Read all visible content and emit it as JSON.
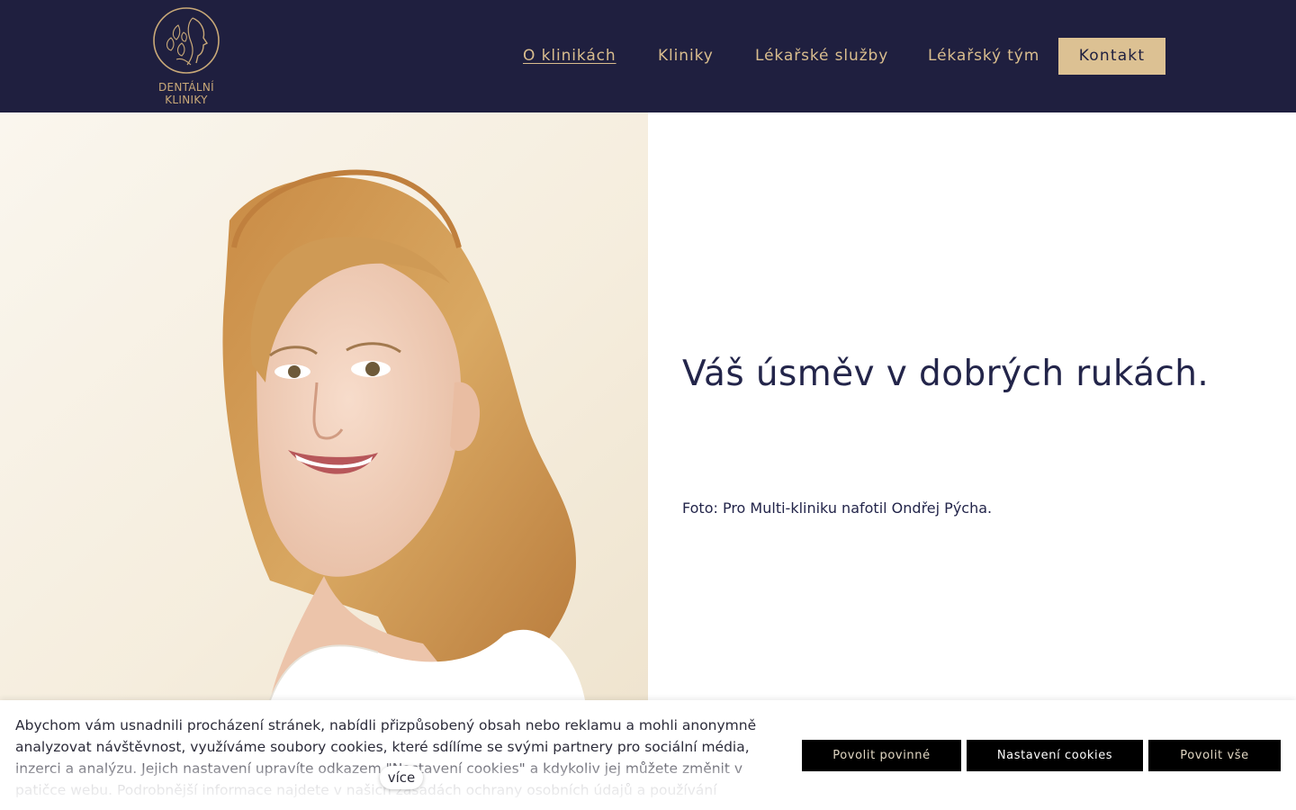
{
  "colors": {
    "header_bg": "#1f1f3f",
    "accent_gold": "#d9bd8e",
    "contact_button_bg": "#dcc193",
    "title_color": "#23254a",
    "cookie_button_bg": "#000000"
  },
  "brand": {
    "logo_icon": "face-leaf-logo-icon",
    "logo_line1": "DENTÁLNÍ",
    "logo_line2": "KLINIKY"
  },
  "nav": {
    "items": [
      {
        "label": "O klinikách",
        "active": true
      },
      {
        "label": "Kliniky",
        "active": false
      },
      {
        "label": "Lékařské služby",
        "active": false
      },
      {
        "label": "Lékařský tým",
        "active": false
      }
    ],
    "contact_label": "Kontakt"
  },
  "hero": {
    "title": "Váš úsměv v dobrých rukách.",
    "caption": "Foto: Pro Multi-kliniku nafotil Ondřej Pýcha."
  },
  "cookies": {
    "text": "Abychom vám usnadnili procházení stránek, nabídli přizpůsobený obsah nebo reklamu a mohli anonymně analyzovat návštěvnost, využíváme soubory cookies, které sdílíme se svými partnery pro sociální média, inzerci a analýzu. Jejich nastavení upravíte odkazem \"Nastavení cookies\" a kdykoliv jej můžete změnit v patičce webu. Podrobnější informace najdete v našich zásadách ochrany osobních údajů a používání",
    "more_label": "více",
    "btn_required": "Povolit povinné",
    "btn_settings": "Nastavení cookies",
    "btn_all": "Povolit vše"
  }
}
